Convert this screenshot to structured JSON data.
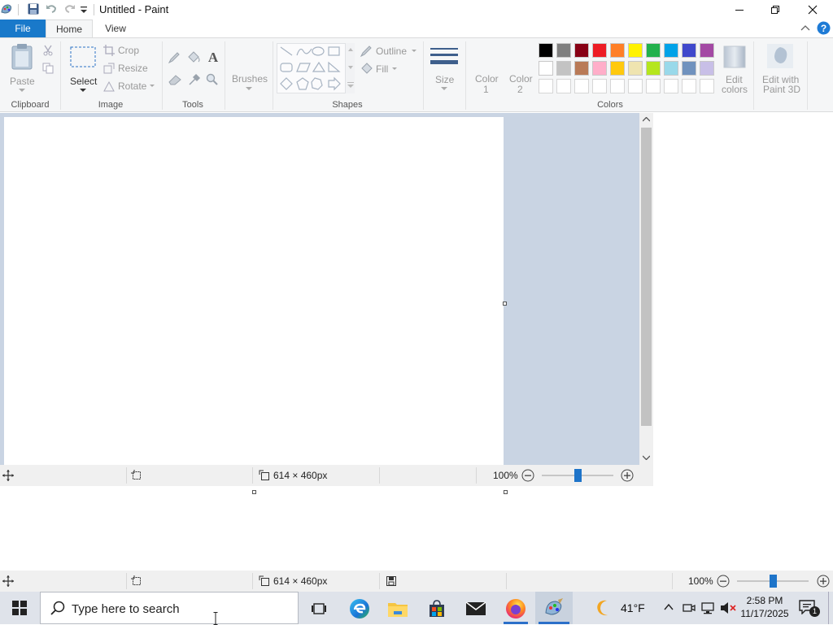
{
  "window": {
    "title": "Untitled - Paint"
  },
  "tabs": {
    "file": "File",
    "home": "Home",
    "view": "View"
  },
  "ribbon": {
    "clipboard": {
      "paste": "Paste",
      "label": "Clipboard"
    },
    "image": {
      "select": "Select",
      "crop": "Crop",
      "resize": "Resize",
      "rotate": "Rotate",
      "label": "Image"
    },
    "tools": {
      "label": "Tools"
    },
    "brushes": {
      "label": "Brushes"
    },
    "shapes": {
      "outline": "Outline",
      "fill": "Fill",
      "label": "Shapes"
    },
    "size": {
      "label": "Size"
    },
    "color1": {
      "line1": "Color",
      "line2": "1"
    },
    "color2": {
      "line1": "Color",
      "line2": "2"
    },
    "colors": {
      "label": "Colors",
      "row1": [
        "#000000",
        "#7f7f7f",
        "#880015",
        "#ed1c24",
        "#ff7f27",
        "#fff200",
        "#22b14c",
        "#00a2e8",
        "#3f48cc",
        "#a349a4"
      ],
      "row2": [
        "#ffffff",
        "#c3c3c3",
        "#b97a57",
        "#ffaec9",
        "#ffc90e",
        "#efe4b0",
        "#b5e61d",
        "#99d9ea",
        "#7092be",
        "#c8bfe7"
      ]
    },
    "edit_colors": {
      "line1": "Edit",
      "line2": "colors"
    },
    "paint3d": {
      "line1": "Edit with",
      "line2": "Paint 3D"
    }
  },
  "status": {
    "canvas_size": "614 × 460px",
    "zoom": "100%",
    "zoom_fraction": 0.5
  },
  "status2": {
    "canvas_size": "614 × 460px",
    "zoom": "100%"
  },
  "taskbar": {
    "search_placeholder": "Type here to search",
    "weather": "41°F",
    "time": "2:58 PM",
    "date": "11/17/2025",
    "notification_count": "1"
  }
}
